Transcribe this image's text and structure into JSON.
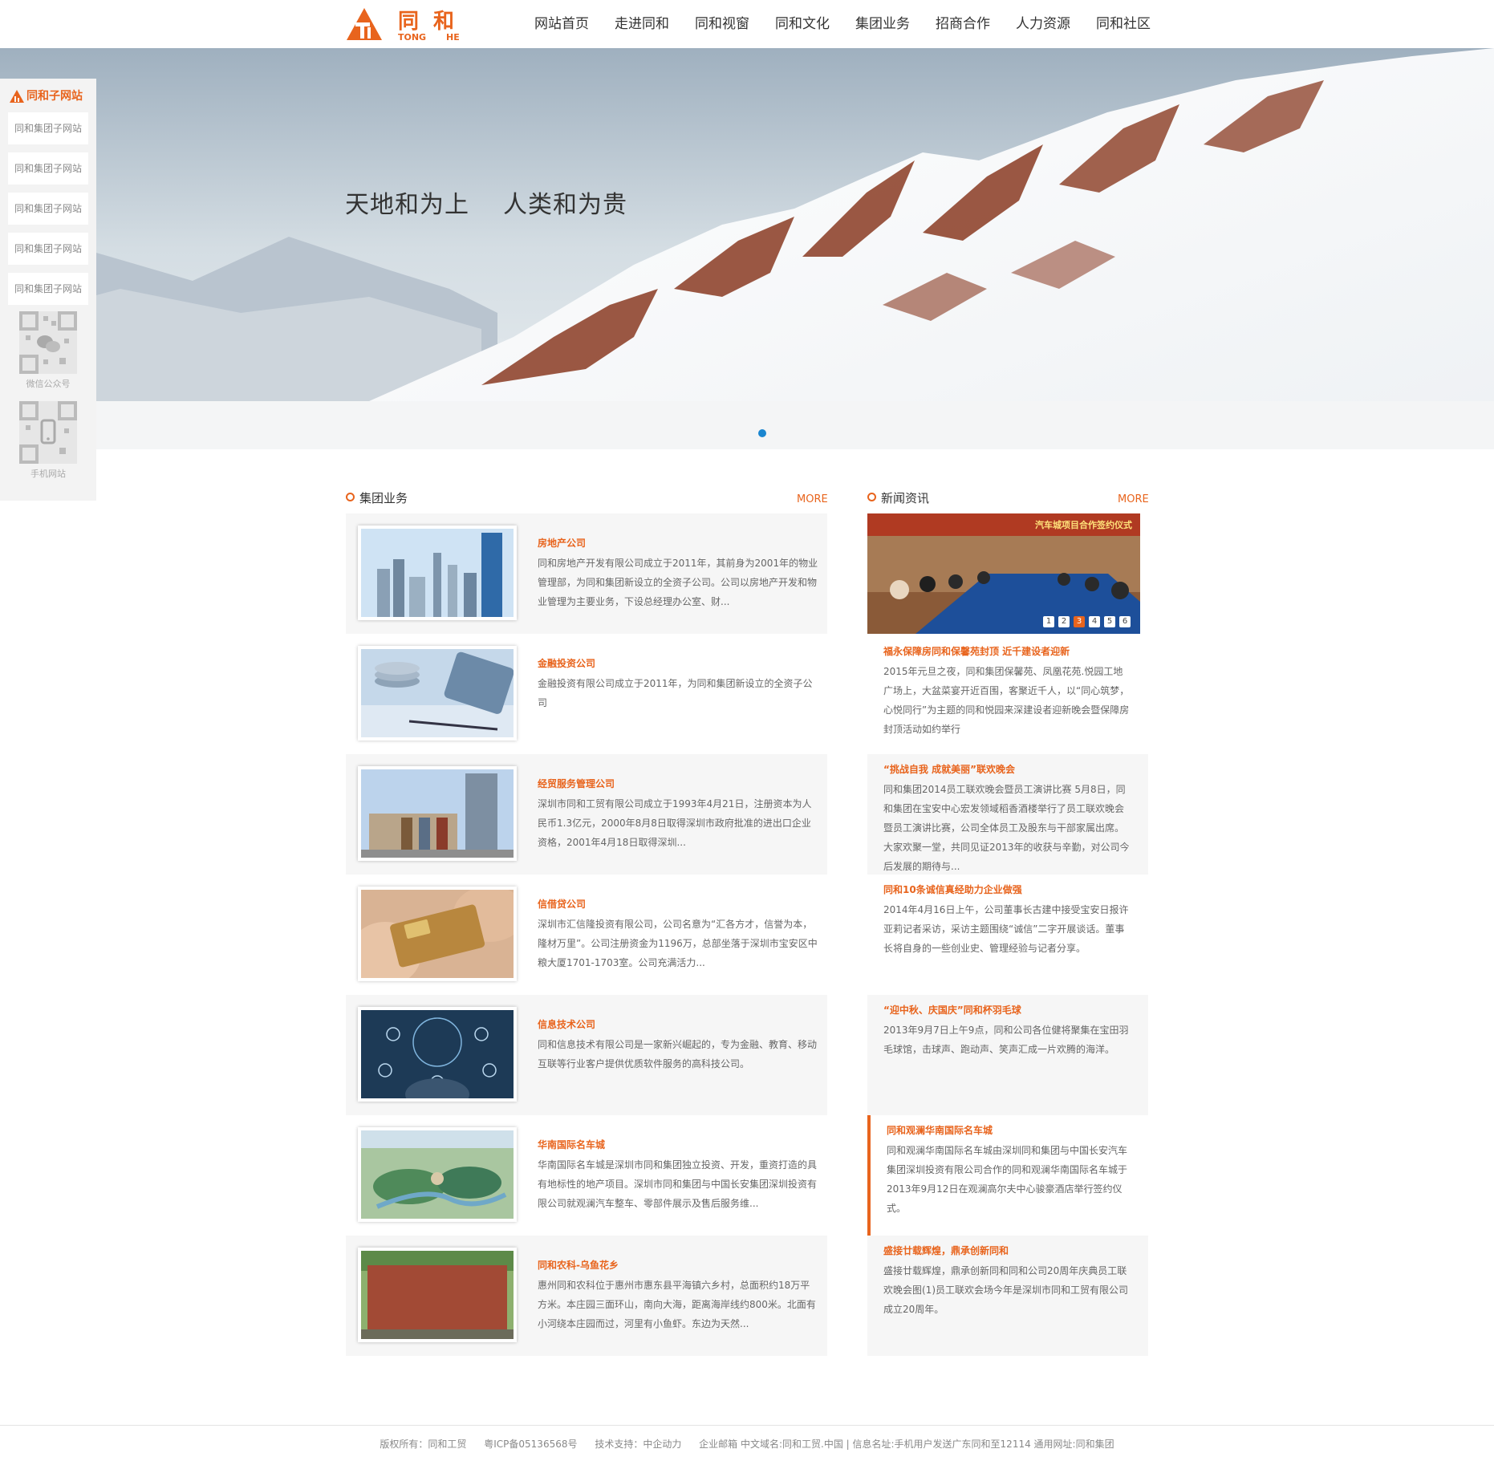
{
  "logo": {
    "cn": "同和",
    "en_left": "TONG",
    "en_right": "HE"
  },
  "nav": [
    "网站首页",
    "走进同和",
    "同和视窗",
    "同和文化",
    "集团业务",
    "招商合作",
    "人力资源",
    "同和社区"
  ],
  "hero": {
    "slogan_1": "天地和为上",
    "slogan_2": "人类和为贵"
  },
  "sidebar": {
    "title": "同和子网站",
    "links": [
      "同和集团子网站",
      "同和集团子网站",
      "同和集团子网站",
      "同和集团子网站",
      "同和集团子网站"
    ],
    "qr_wechat_label": "微信公众号",
    "qr_mobile_label": "手机网站"
  },
  "business": {
    "title": "集团业务",
    "more": "MORE",
    "items": [
      {
        "title": "房地产公司",
        "desc": "同和房地产开发有限公司成立于2011年，其前身为2001年的物业管理部，为同和集团新设立的全资子公司。公司以房地产开发和物业管理为主要业务，下设总经理办公室、财..."
      },
      {
        "title": "金融投资公司",
        "desc": "金融投资有限公司成立于2011年，为同和集团新设立的全资子公司"
      },
      {
        "title": "经贸服务管理公司",
        "desc": "深圳市同和工贸有限公司成立于1993年4月21日，注册资本为人民币1.3亿元，2000年8月8日取得深圳市政府批准的进出口企业资格，2001年4月18日取得深圳..."
      },
      {
        "title": "信借贷公司",
        "desc": "深圳市汇信隆投资有限公司，公司名意为“汇各方才，信誉为本，隆材万里”。公司注册资金为1196万，总部坐落于深圳市宝安区中粮大厦1701-1703室。公司充满活力..."
      },
      {
        "title": "信息技术公司",
        "desc": "同和信息技术有限公司是一家新兴崛起的，专为金融、教育、移动互联等行业客户提供优质软件服务的高科技公司。"
      },
      {
        "title": "华南国际名车城",
        "desc": "华南国际名车城是深圳市同和集团独立投资、开发，重资打造的具有地标性的地产项目。深圳市同和集团与中国长安集团深圳投资有限公司就观澜汽车整车、零部件展示及售后服务维..."
      },
      {
        "title": "同和农科-乌鱼花乡",
        "desc": "惠州同和农科位于惠州市惠东县平海镇六乡村，总面积约18万平方米。本庄园三面环山，南向大海，距离海岸线约800米。北面有小河绕本庄园而过，河里有小鱼虾。东边为天然..."
      }
    ]
  },
  "news": {
    "title": "新闻资讯",
    "more": "MORE",
    "image_banner_text": "汽车城项目合作签约仪式",
    "pager": [
      "1",
      "2",
      "3",
      "4",
      "5",
      "6"
    ],
    "items": [
      {
        "title": "福永保障房同和保馨苑封顶 近千建设者迎新",
        "desc": "2015年元旦之夜，同和集团保馨苑、凤凰花苑.悦园工地广场上，大盆菜宴开近百围，客聚近千人，以“同心筑梦，心悦同行”为主题的同和悦园来深建设者迎新晚会暨保障房封顶活动如约举行"
      },
      {
        "title": "“挑战自我 成就美丽”联欢晚会",
        "desc": "同和集团2014员工联欢晚会暨员工演讲比赛 5月8日，同和集团在宝安中心宏发领域稻香酒楼举行了员工联欢晚会暨员工演讲比赛，公司全体员工及股东与干部家属出席。大家欢聚一堂，共同见证2013年的收获与辛勤，对公司今后发展的期待与..."
      },
      {
        "title": "同和10条诚信真经助力企业做强",
        "desc": "2014年4月16日上午，公司董事长古建中接受宝安日报许亚莉记者采访，采访主题围绕“诚信”二字开展谈话。董事长将自身的一些创业史、管理经验与记者分享。"
      },
      {
        "title": "“迎中秋、庆国庆”同和杯羽毛球",
        "desc": "2013年9月7日上午9点，同和公司各位健将聚集在宝田羽毛球馆，击球声、跑动声、笑声汇成一片欢腾的海洋。"
      },
      {
        "title": "同和观澜华南国际名车城",
        "desc": "同和观澜华南国际名车城由深圳同和集团与中国长安汽车集团深圳投资有限公司合作的同和观澜华南国际名车城于2013年9月12日在观澜高尔夫中心骏豪酒店举行签约仪式。"
      },
      {
        "title": "盛接廿载辉煌，鼎承创新同和",
        "desc": "盛接廿载辉煌，鼎承创新同和同和公司20周年庆典员工联欢晚会图(1)员工联欢会场今年是深圳市同和工贸有限公司成立20周年。"
      }
    ]
  },
  "footer": [
    "版权所有：同和工贸",
    "粤ICP备05136568号",
    "技术支持：中企动力",
    "企业邮箱 中文域名:同和工贸.中国 | 信息名址:手机用户发送广东同和至12114 通用网址:同和集团"
  ],
  "colors": {
    "accent": "#e8641d",
    "dot": "#1a86d0",
    "grey_bg": "#f6f6f6"
  }
}
